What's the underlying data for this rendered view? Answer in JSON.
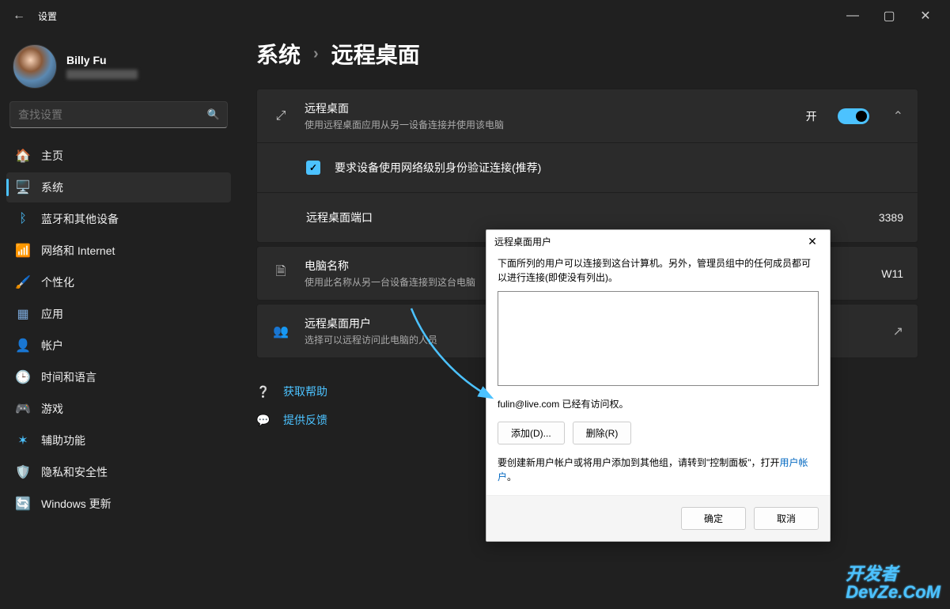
{
  "window": {
    "title": "设置"
  },
  "profile": {
    "name": "Billy Fu"
  },
  "search": {
    "placeholder": "查找设置"
  },
  "nav": [
    {
      "icon": "🏠",
      "label": "主页",
      "color": "#f7b955"
    },
    {
      "icon": "🖥️",
      "label": "系统",
      "color": "#4cc2ff",
      "active": true
    },
    {
      "icon": "ᛒ",
      "label": "蓝牙和其他设备",
      "color": "#4cc2ff"
    },
    {
      "icon": "📶",
      "label": "网络和 Internet",
      "color": "#4cc2ff"
    },
    {
      "icon": "🖌️",
      "label": "个性化",
      "color": "#d68b5a"
    },
    {
      "icon": "▦",
      "label": "应用",
      "color": "#7aa7d8"
    },
    {
      "icon": "👤",
      "label": "帐户",
      "color": "#e08a7a"
    },
    {
      "icon": "🕒",
      "label": "时间和语言",
      "color": "#4cc2ff"
    },
    {
      "icon": "🎮",
      "label": "游戏",
      "color": "#aaa"
    },
    {
      "icon": "✶",
      "label": "辅助功能",
      "color": "#4cc2ff"
    },
    {
      "icon": "🛡️",
      "label": "隐私和安全性",
      "color": "#aaa"
    },
    {
      "icon": "🔄",
      "label": "Windows 更新",
      "color": "#4cc2ff"
    }
  ],
  "breadcrumb": {
    "root": "系统",
    "page": "远程桌面"
  },
  "panel": {
    "rd_title": "远程桌面",
    "rd_desc": "使用远程桌面应用从另一设备连接并使用该电脑",
    "toggle_label": "开",
    "nla_label": "要求设备使用网络级别身份验证连接(推荐)",
    "port_label": "远程桌面端口",
    "port_value": "3389",
    "pcname_title": "电脑名称",
    "pcname_desc": "使用此名称从另一台设备连接到这台电脑",
    "pcname_value": "W11",
    "users_title": "远程桌面用户",
    "users_desc": "选择可以远程访问此电脑的人员"
  },
  "links": {
    "help": "获取帮助",
    "feedback": "提供反馈"
  },
  "dialog": {
    "title": "远程桌面用户",
    "desc": "下面所列的用户可以连接到这台计算机。另外，管理员组中的任何成员都可以进行连接(即使没有列出)。",
    "access_user": "fulin@live.com",
    "access_suffix": " 已经有访问权。",
    "add": "添加(D)...",
    "remove": "删除(R)",
    "hint_prefix": "要创建新用户帐户或将用户添加到其他组，请转到\"控制面板\"，打开",
    "hint_link": "用户帐户",
    "hint_suffix": "。",
    "ok": "确定",
    "cancel": "取消"
  },
  "watermark": {
    "l1": "开发者",
    "l2": "DevZe.CoM"
  }
}
